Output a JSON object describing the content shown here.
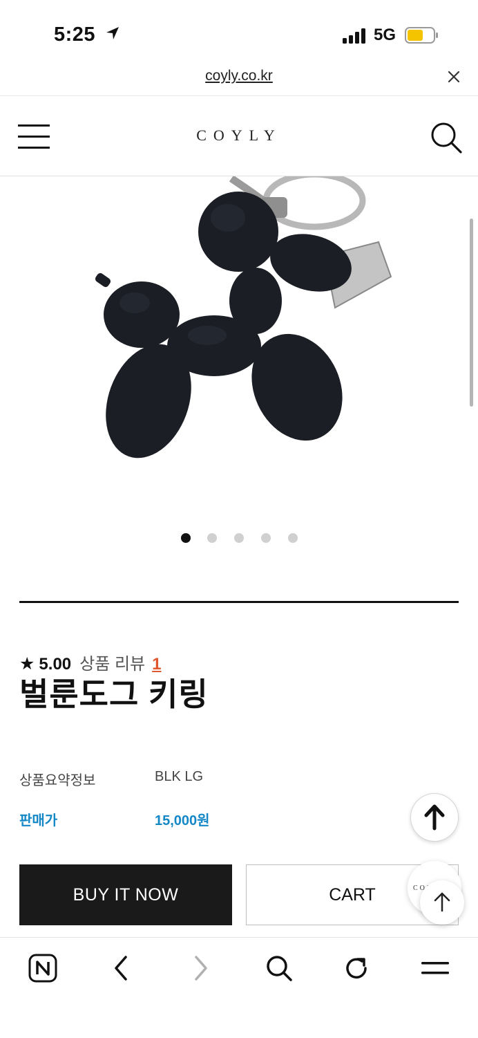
{
  "status_bar": {
    "time": "5:25",
    "network": "5G"
  },
  "browser": {
    "url": "coyly.co.kr"
  },
  "header": {
    "logo": "COYLY"
  },
  "carousel": {
    "count": 5,
    "active": 0
  },
  "product": {
    "rating": "5.00",
    "rating_star": "★",
    "review_label": "상품 리뷰",
    "review_count": "1",
    "title": "벌룬도그 키링",
    "info": [
      {
        "label": "상품요약정보",
        "value": "BLK LG"
      },
      {
        "label": "판매가",
        "value": "15,000원"
      }
    ]
  },
  "actions": {
    "buy_now": "BUY IT NOW",
    "cart": "CART"
  },
  "chat_bubble": {
    "text": "COY"
  },
  "colors": {
    "price": "#1487c7",
    "review_count": "#e0572e",
    "buy_button": "#1a1a1a"
  }
}
